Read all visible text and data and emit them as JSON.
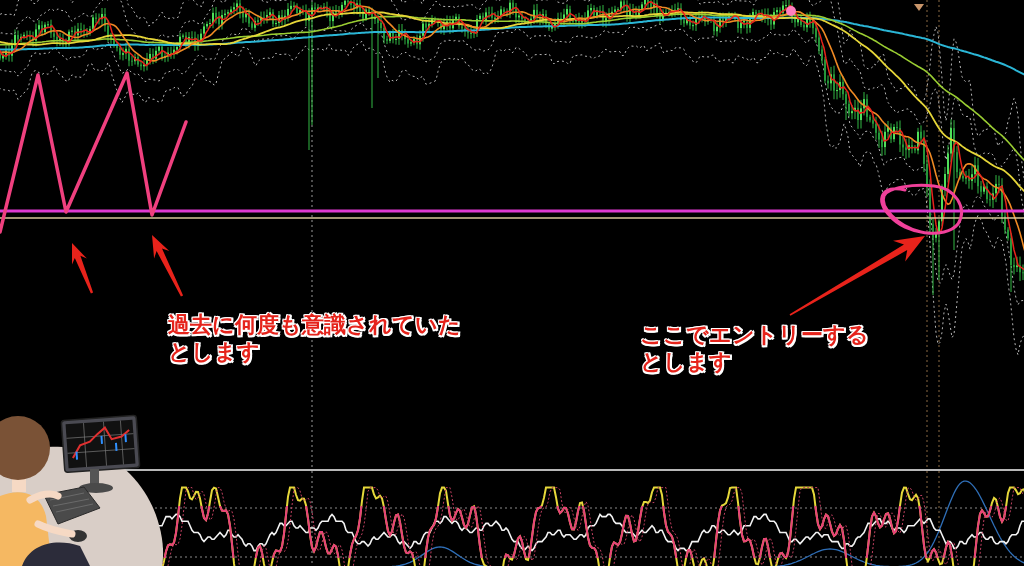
{
  "chart": {
    "annotations": [
      {
        "lines": [
          "過去に何度も意識されていた",
          "とします"
        ]
      },
      {
        "lines": [
          "ここでエントリーする",
          "とします"
        ]
      }
    ]
  }
}
